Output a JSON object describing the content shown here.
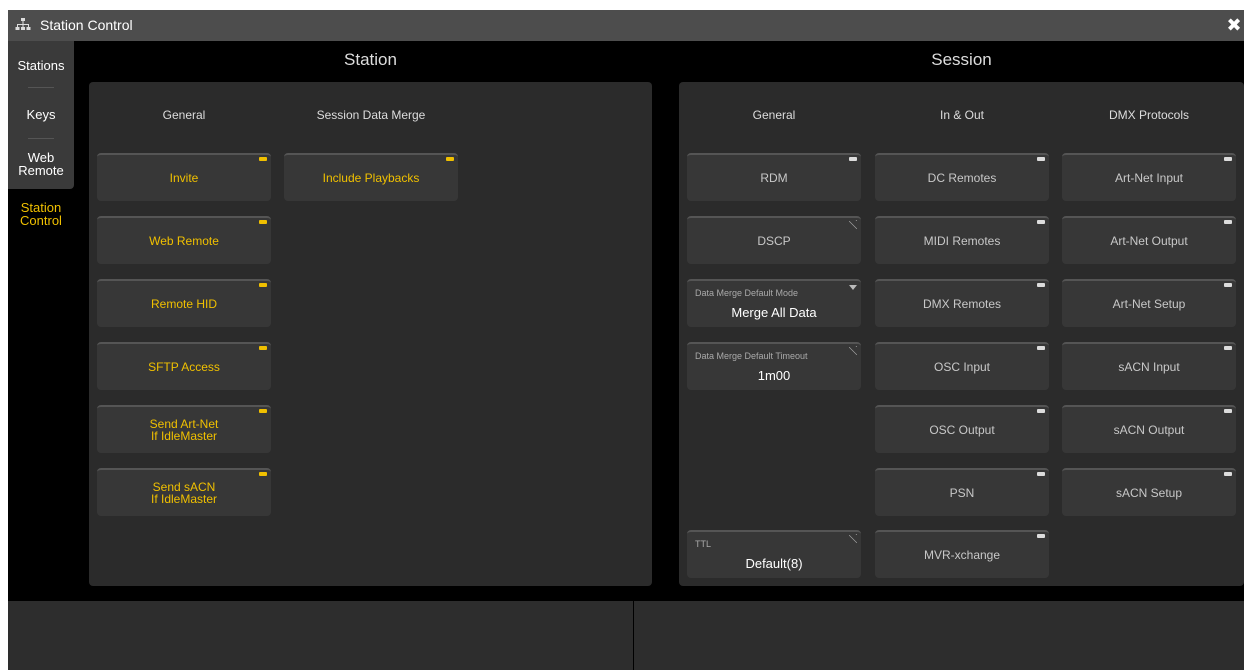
{
  "window": {
    "title": "Station Control",
    "close_label": "✖"
  },
  "sidebar": {
    "items": [
      {
        "label": "Stations"
      },
      {
        "label": "Keys"
      },
      {
        "label": "Web\nRemote"
      },
      {
        "label": "Station\nControl"
      }
    ]
  },
  "station": {
    "heading": "Station",
    "general": {
      "header": "General",
      "buttons": [
        {
          "label": "Invite"
        },
        {
          "label": "Web Remote"
        },
        {
          "label": "Remote HID"
        },
        {
          "label": "SFTP Access"
        },
        {
          "label": "Send Art-Net\nIf IdleMaster"
        },
        {
          "label": "Send sACN\nIf IdleMaster"
        }
      ]
    },
    "merge": {
      "header": "Session Data Merge",
      "buttons": [
        {
          "label": "Include Playbacks"
        }
      ]
    }
  },
  "session": {
    "heading": "Session",
    "general": {
      "header": "General",
      "rdm": "RDM",
      "dscp": "DSCP",
      "merge_mode": {
        "label": "Data Merge Default Mode",
        "value": "Merge All Data"
      },
      "merge_timeout": {
        "label": "Data Merge Default Timeout",
        "value": "1m00"
      },
      "ttl": {
        "label": "TTL",
        "value": "Default(8)"
      }
    },
    "inout": {
      "header": "In & Out",
      "buttons": [
        {
          "label": "DC Remotes"
        },
        {
          "label": "MIDI Remotes"
        },
        {
          "label": "DMX Remotes"
        },
        {
          "label": "OSC Input"
        },
        {
          "label": "OSC Output"
        },
        {
          "label": "PSN"
        },
        {
          "label": "MVR-xchange"
        }
      ]
    },
    "dmx": {
      "header": "DMX Protocols",
      "buttons": [
        {
          "label": "Art-Net Input"
        },
        {
          "label": "Art-Net Output"
        },
        {
          "label": "Art-Net Setup"
        },
        {
          "label": "sACN Input"
        },
        {
          "label": "sACN Output"
        },
        {
          "label": "sACN Setup"
        }
      ]
    }
  },
  "colors": {
    "accent_yellow": "#f0c000",
    "panel": "#2b2b2b",
    "button": "#373737"
  }
}
